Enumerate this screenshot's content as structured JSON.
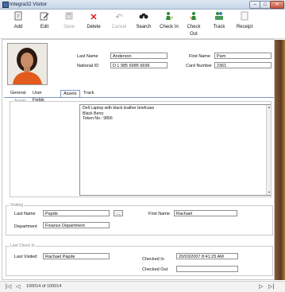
{
  "window": {
    "title": "Integra32 Visitor",
    "controls": {
      "minimize": "–",
      "maximize": "□",
      "close": "✕"
    }
  },
  "toolbar": {
    "add": "Add",
    "edit": "Edit",
    "save": "Save",
    "delete": "Delete",
    "cancel": "Cancel",
    "search": "Search",
    "check_in": "Check In",
    "check_out": "Check Out",
    "track": "Track",
    "receipt": "Receipt"
  },
  "visitor": {
    "last_name_label": "Last Name",
    "last_name": "Anderson",
    "national_id_label": "National ID",
    "national_id": "D L 985 6985 6696",
    "first_name_label": "First Name",
    "first_name": "Pam",
    "card_number_label": "Card Number",
    "card_number": "2361"
  },
  "tabs": [
    {
      "label": "General"
    },
    {
      "label": "User Fields"
    },
    {
      "label": "Assets"
    },
    {
      "label": "Track"
    }
  ],
  "assets": {
    "group_title": "Assets",
    "lines": [
      "Dell Laptop with black leather briefcase",
      "Black Berry",
      "Token No.: 9856"
    ]
  },
  "visiting": {
    "group_title": "Visiting",
    "last_name_label": "Last Name",
    "last_name": "Papde",
    "browse_label": "...",
    "first_name_label": "First Name",
    "first_name": "Rachael",
    "department_label": "Department",
    "department": "Finance Department"
  },
  "last_checkin": {
    "group_title": "Last Check In",
    "last_visited_label": "Last Visited",
    "last_visited": "Rachael Papde",
    "checked_in_label": "Checked In",
    "checked_in": "20/03/2007 8:41:25 AM",
    "checked_out_label": "Checked Out",
    "checked_out": ""
  },
  "navigation": {
    "first": "|◁",
    "prev": "◁",
    "record_text": "100014 of 100014",
    "next": "▷",
    "last": "▷|"
  },
  "colors": {
    "delete_red": "#d42020",
    "tab_border": "#7a97c4"
  }
}
